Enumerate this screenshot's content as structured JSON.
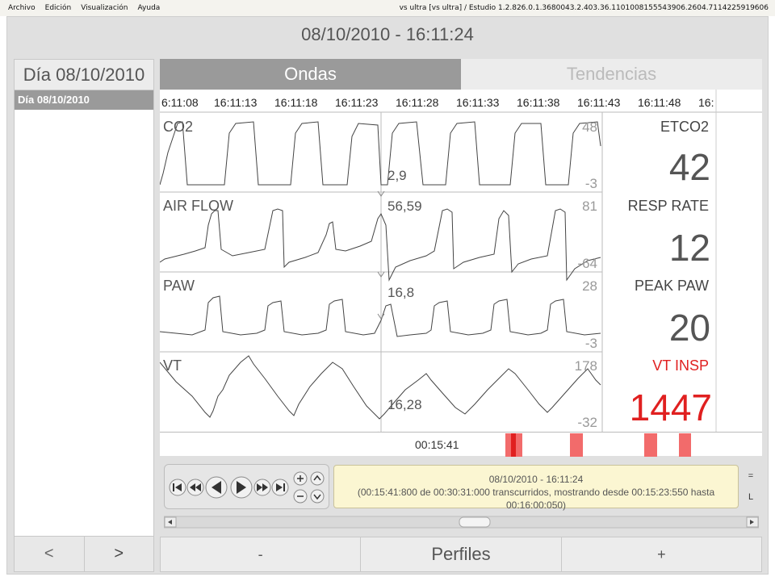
{
  "menubar": {
    "items": [
      "Archivo",
      "Edición",
      "Visualización",
      "Ayuda"
    ],
    "window_title": "vs ultra [vs ultra] / Estudio 1.2.826.0.1.3680043.2.403.36.1101008155543906.2604.7114225919606"
  },
  "header": {
    "title": "08/10/2010 - 16:11:24"
  },
  "left_panel": {
    "title": "Día  08/10/2010",
    "items": [
      "Día  08/10/2010"
    ],
    "prev_label": "<",
    "next_label": ">"
  },
  "tabs": [
    {
      "label": "Ondas",
      "active": true
    },
    {
      "label": "Tendencias",
      "active": false
    }
  ],
  "time_axis": [
    "6:11:08",
    "16:11:13",
    "16:11:18",
    "16:11:23",
    "16:11:28",
    "16:11:33",
    "16:11:38",
    "16:11:43",
    "16:11:48",
    "16:"
  ],
  "channels": [
    {
      "name": "CO2",
      "scale_max": "48",
      "scale_min": "-3",
      "cursor_value": "2,9",
      "param_label": "ETCO2",
      "param_value": "42",
      "alarm": false
    },
    {
      "name": "AIR FLOW",
      "scale_max": "81",
      "scale_min": "-64",
      "cursor_value": "56,59",
      "param_label": "RESP RATE",
      "param_value": "12",
      "alarm": false
    },
    {
      "name": "PAW",
      "scale_max": "28",
      "scale_min": "-3",
      "cursor_value": "16,8",
      "param_label": "PEAK PAW",
      "param_value": "20",
      "alarm": false
    },
    {
      "name": "VT",
      "scale_max": "178",
      "scale_min": "-32",
      "cursor_value": "16,28",
      "param_label": "VT INSP",
      "param_value": "1447",
      "alarm": true
    }
  ],
  "timeline": {
    "elapsed": "00:15:41"
  },
  "info": {
    "line1": "08/10/2010 - 16:11:24",
    "line2": "(00:15:41:800 de 00:30:31:000 transcurridos, mostrando desde 00:15:23:550 hasta 00:16:00:050)"
  },
  "side_buttons": [
    "=",
    "L"
  ],
  "bottom_bar": {
    "minus_label": "-",
    "profiles_label": "Perfiles",
    "plus_label": "+"
  },
  "colors": {
    "alarm": "#e02020",
    "timeline_marker": "#f26b6b",
    "selected_bg": "#9a9a9a",
    "info_bg": "#fbf6d2"
  }
}
